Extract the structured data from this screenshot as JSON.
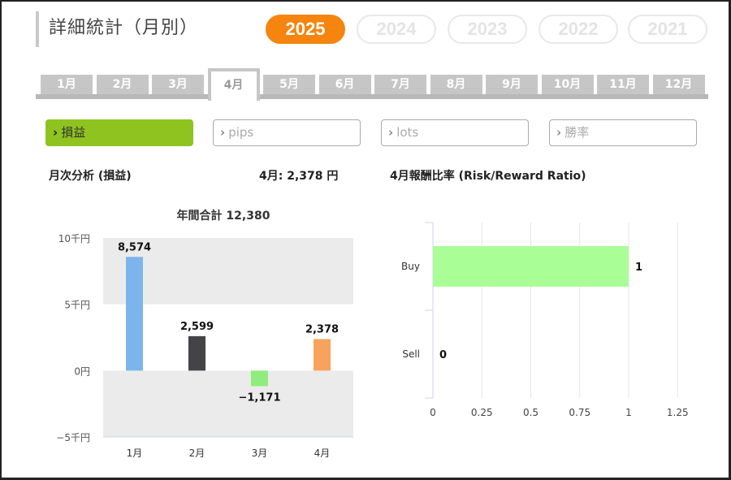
{
  "header": {
    "title": "詳細統計（月別）"
  },
  "years": [
    "2025",
    "2024",
    "2023",
    "2022",
    "2021"
  ],
  "selected_year": "2025",
  "months": [
    "1月",
    "2月",
    "3月",
    "4月",
    "5月",
    "6月",
    "7月",
    "8月",
    "9月",
    "10月",
    "11月",
    "12月"
  ],
  "selected_month": "4月",
  "metrics": [
    {
      "label": "損益",
      "active": true
    },
    {
      "label": "pips",
      "active": false
    },
    {
      "label": "lots",
      "active": false
    },
    {
      "label": "勝率",
      "active": false
    }
  ],
  "summary": {
    "left_title": "月次分析 (損益)",
    "month_value": "4月:  2,378 円",
    "right_title": "4月報酬比率 (Risk/Reward Ratio)"
  },
  "chart_data": [
    {
      "type": "bar",
      "title": "年間合計 12,380",
      "categories": [
        "1月",
        "2月",
        "3月",
        "4月"
      ],
      "values": [
        8574,
        2599,
        -1171,
        2378
      ],
      "value_labels": [
        "8,574",
        "2,599",
        "−1,171",
        "2,378"
      ],
      "colors": [
        "#7cb5ec",
        "#434348",
        "#90ed7d",
        "#f7a35c"
      ],
      "yticks": [
        10000,
        5000,
        0,
        -5000
      ],
      "ytick_labels": [
        "10千円",
        "5千円",
        "0円",
        "−5千円"
      ],
      "ylim": [
        -5000,
        10000
      ]
    },
    {
      "type": "bar",
      "orientation": "horizontal",
      "categories": [
        "Buy",
        "Sell"
      ],
      "values": [
        1,
        0
      ],
      "value_labels": [
        "1",
        "0"
      ],
      "color": "#a9ff96",
      "xticks": [
        0,
        0.25,
        0.5,
        0.75,
        1,
        1.25
      ],
      "xtick_labels": [
        "0",
        "0.25",
        "0.5",
        "0.75",
        "1",
        "1.25"
      ],
      "xlim": [
        0,
        1.25
      ]
    }
  ]
}
